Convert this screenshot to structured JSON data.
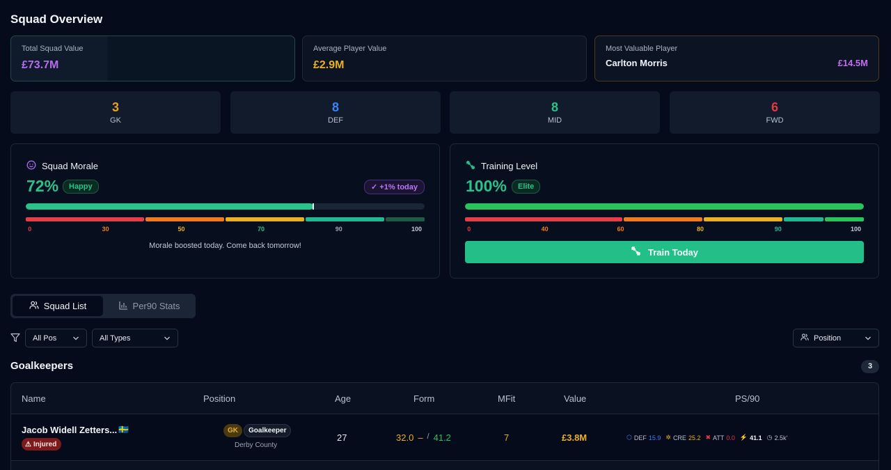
{
  "page": {
    "title": "Squad Overview"
  },
  "stats": {
    "total": {
      "label": "Total Squad Value",
      "value": "£73.7M"
    },
    "average": {
      "label": "Average Player Value",
      "value": "£2.9M"
    },
    "mvp": {
      "label": "Most Valuable Player",
      "name": "Carlton Morris",
      "value": "£14.5M"
    }
  },
  "positions": [
    {
      "count": "3",
      "label": "GK",
      "color": "#e7a21c"
    },
    {
      "count": "8",
      "label": "DEF",
      "color": "#3b82f6"
    },
    {
      "count": "8",
      "label": "MID",
      "color": "#2ac28a"
    },
    {
      "count": "6",
      "label": "FWD",
      "color": "#e5393f"
    }
  ],
  "morale": {
    "title": "Squad Morale",
    "percent": "72%",
    "level": 72,
    "status": "Happy",
    "change": "+1% today",
    "scale": [
      "0",
      "30",
      "50",
      "70",
      "90",
      "100"
    ],
    "message": "Morale boosted today. Come back tomorrow!"
  },
  "training": {
    "title": "Training Level",
    "percent": "100%",
    "level": 100,
    "status": "Elite",
    "scale": [
      "0",
      "40",
      "60",
      "80",
      "90",
      "100"
    ],
    "button": "Train Today"
  },
  "tabs": {
    "squad_list": "Squad List",
    "per90": "Per90 Stats"
  },
  "filters": {
    "position": "All Pos",
    "types": "All Types",
    "sort": "Position"
  },
  "section": {
    "title": "Goalkeepers",
    "count": "3"
  },
  "table": {
    "headers": {
      "name": "Name",
      "position": "Position",
      "age": "Age",
      "form": "Form",
      "mfit": "MFit",
      "value": "Value",
      "ps90": "PS/90"
    },
    "rows": [
      {
        "name": "Jacob Widell Zetters...",
        "flag": "🇸🇪",
        "status": "Injured",
        "pos_short": "GK",
        "pos_long": "Goalkeeper",
        "club": "Derby County",
        "age": "27",
        "form_current": "32.0",
        "form_trend": "–",
        "form_sep": "/",
        "form_peak": "41.2",
        "mfit": "7",
        "value": "£3.8M",
        "ps90": {
          "def_label": "DEF",
          "def": "15.9",
          "cre_label": "CRE",
          "cre": "25.2",
          "att_label": "ATT",
          "att": "0.0",
          "total": "41.1",
          "minutes": "2.5k'"
        }
      }
    ]
  }
}
